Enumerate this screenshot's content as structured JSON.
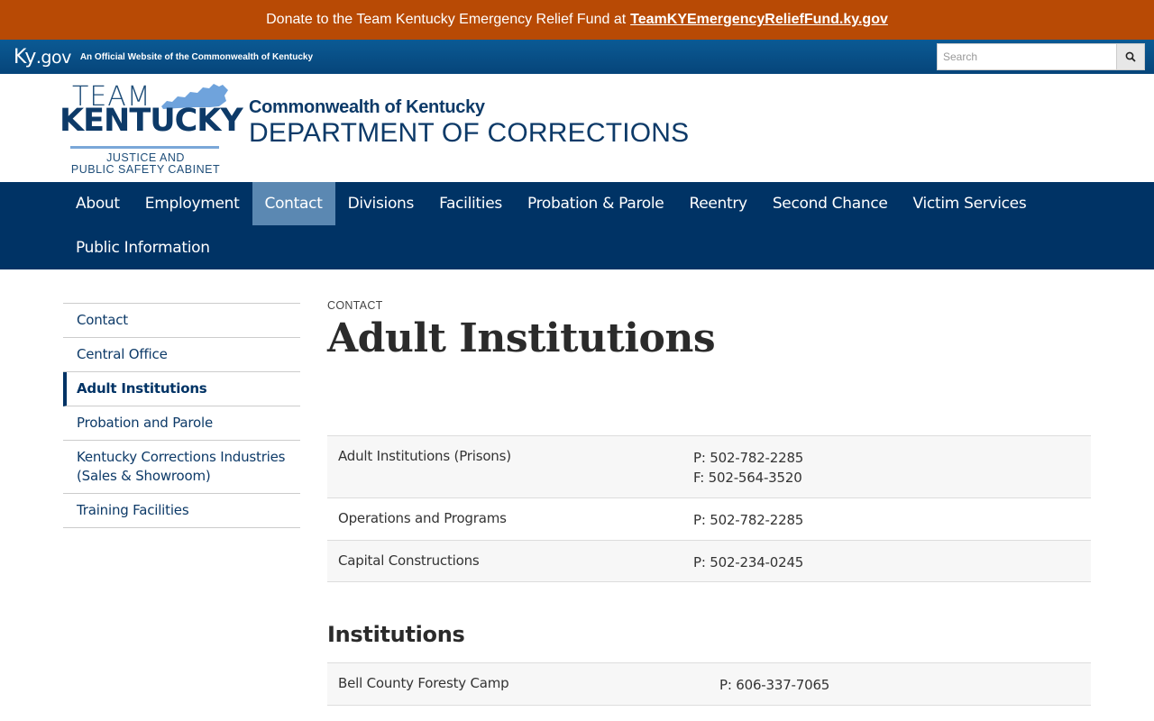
{
  "banner": {
    "text": "Donate to the Team Kentucky Emergency Relief Fund at",
    "link": "TeamKYEmergencyReliefFund.ky.gov"
  },
  "kybar": {
    "logo_ky": "Ky",
    "logo_gov": ".gov",
    "tagline": "An Official Website of the Commonwealth of Kentucky",
    "search_placeholder": "Search"
  },
  "header": {
    "logo_team": "TEAM",
    "logo_kentucky": "KENTUCKY",
    "logo_cabinet_line1": "JUSTICE AND",
    "logo_cabinet_line2": "PUBLIC SAFETY CABINET",
    "commonwealth": "Commonwealth of Kentucky",
    "department": "DEPARTMENT OF CORRECTIONS"
  },
  "nav": {
    "row1": [
      "About",
      "Employment",
      "Contact",
      "Divisions",
      "Facilities",
      "Probation & Parole",
      "Reentry",
      "Second Chance",
      "Victim Services"
    ],
    "row2": [
      "Public Information"
    ],
    "active": "Contact"
  },
  "sidebar": {
    "items": [
      "Contact",
      "Central Office",
      "Adult Institutions",
      "Probation and Parole",
      "Kentucky Corrections Industries (Sales & Showroom)",
      "Training Facilities"
    ],
    "active": "Adult Institutions"
  },
  "main": {
    "breadcrumb": "CONTACT",
    "title": "Adult Institutions",
    "contacts": [
      {
        "name": "Adult Institutions (Prisons)",
        "lines": [
          "P: 502-782-2285",
          "F: 502-564-3520"
        ]
      },
      {
        "name": "Operations and Programs",
        "lines": [
          "P: 502-782-2285"
        ]
      },
      {
        "name": "Capital Constructions",
        "lines": [
          "P: 502-234-0245"
        ]
      }
    ],
    "institutions_heading": "Institutions",
    "institutions": [
      {
        "name": "Bell County Foresty Camp",
        "lines": [
          "P: 606-337-7065"
        ]
      }
    ]
  },
  "colors": {
    "banner": "#b84a05",
    "nav": "#003365",
    "nav_active": "#5b88b2",
    "brand": "#0d3a68"
  }
}
